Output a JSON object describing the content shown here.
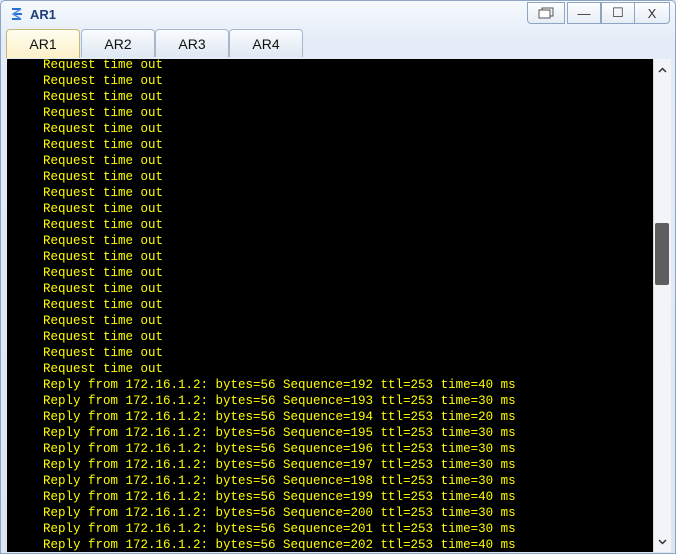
{
  "window": {
    "title": "AR1",
    "controls": {
      "restore_icon": "restore-icon",
      "minimize_label": "—",
      "maximize_label": "☐",
      "close_label": "X"
    }
  },
  "tabs": [
    {
      "label": "AR1",
      "active": true
    },
    {
      "label": "AR2",
      "active": false
    },
    {
      "label": "AR3",
      "active": false
    },
    {
      "label": "AR4",
      "active": false
    }
  ],
  "terminal": {
    "text_color": "#ffff00",
    "background": "#000000",
    "lines": [
      "Request time out",
      "Request time out",
      "Request time out",
      "Request time out",
      "Request time out",
      "Request time out",
      "Request time out",
      "Request time out",
      "Request time out",
      "Request time out",
      "Request time out",
      "Request time out",
      "Request time out",
      "Request time out",
      "Request time out",
      "Request time out",
      "Request time out",
      "Request time out",
      "Request time out",
      "Request time out",
      "Reply from 172.16.1.2: bytes=56 Sequence=192 ttl=253 time=40 ms",
      "Reply from 172.16.1.2: bytes=56 Sequence=193 ttl=253 time=30 ms",
      "Reply from 172.16.1.2: bytes=56 Sequence=194 ttl=253 time=20 ms",
      "Reply from 172.16.1.2: bytes=56 Sequence=195 ttl=253 time=30 ms",
      "Reply from 172.16.1.2: bytes=56 Sequence=196 ttl=253 time=30 ms",
      "Reply from 172.16.1.2: bytes=56 Sequence=197 ttl=253 time=30 ms",
      "Reply from 172.16.1.2: bytes=56 Sequence=198 ttl=253 time=30 ms",
      "Reply from 172.16.1.2: bytes=56 Sequence=199 ttl=253 time=40 ms",
      "Reply from 172.16.1.2: bytes=56 Sequence=200 ttl=253 time=30 ms",
      "Reply from 172.16.1.2: bytes=56 Sequence=201 ttl=253 time=30 ms",
      "Reply from 172.16.1.2: bytes=56 Sequence=202 ttl=253 time=40 ms"
    ]
  },
  "scrollbar": {
    "up_label": "^",
    "down_label": "v",
    "position_fraction": 0.55
  }
}
